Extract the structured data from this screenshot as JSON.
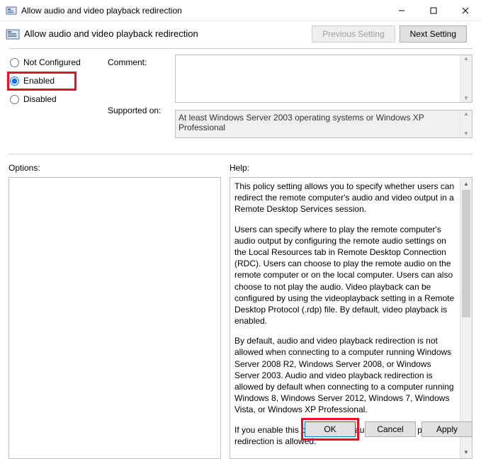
{
  "window": {
    "title": "Allow audio and video playback redirection"
  },
  "header": {
    "title": "Allow audio and video playback redirection",
    "prev_label": "Previous Setting",
    "next_label": "Next Setting"
  },
  "state": {
    "not_configured_label": "Not Configured",
    "enabled_label": "Enabled",
    "disabled_label": "Disabled",
    "selected": "enabled"
  },
  "labels": {
    "comment": "Comment:",
    "supported": "Supported on:",
    "options": "Options:",
    "help": "Help:"
  },
  "fields": {
    "comment_value": "",
    "supported_value": "At least Windows Server 2003 operating systems or Windows XP Professional"
  },
  "help": {
    "p1": "This policy setting allows you to specify whether users can redirect the remote computer's audio and video output in a Remote Desktop Services session.",
    "p2": "Users can specify where to play the remote computer's audio output by configuring the remote audio settings on the Local Resources tab in Remote Desktop Connection (RDC). Users can choose to play the remote audio on the remote computer or on the local computer. Users can also choose to not play the audio. Video playback can be configured by using the videoplayback setting in a Remote Desktop Protocol (.rdp) file. By default, video playback is enabled.",
    "p3": "By default, audio and video playback redirection is not allowed when connecting to a computer running Windows Server 2008 R2, Windows Server 2008, or Windows Server 2003. Audio and video playback redirection is allowed by default when connecting to a computer running Windows 8, Windows Server 2012, Windows 7, Windows Vista, or Windows XP Professional.",
    "p4": "If you enable this policy setting, audio and video playback redirection is allowed."
  },
  "footer": {
    "ok": "OK",
    "cancel": "Cancel",
    "apply": "Apply"
  }
}
